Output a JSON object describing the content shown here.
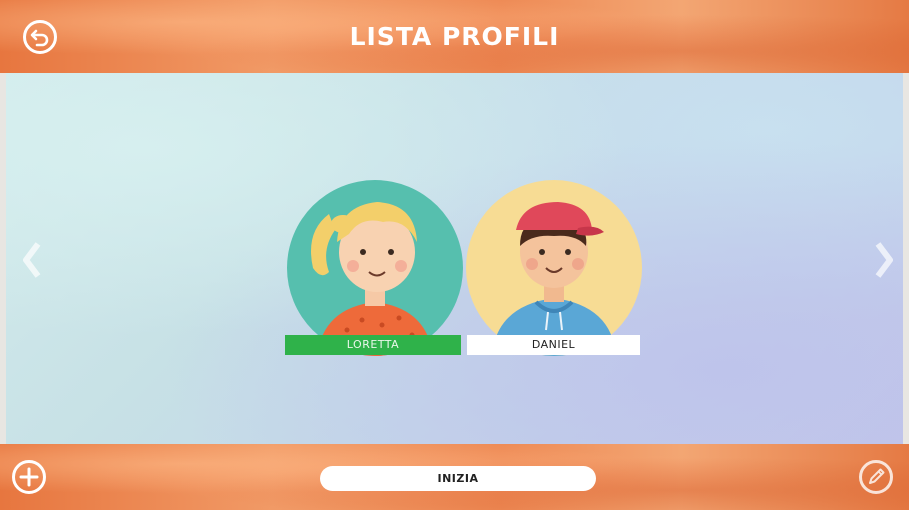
{
  "header": {
    "title": "LISTA PROFILI",
    "back_icon": "back-arrow-circle-icon"
  },
  "profiles": [
    {
      "name": "LORETTA",
      "selected": true,
      "label_color": "#2fb24a",
      "circle_color": "#56bfae"
    },
    {
      "name": "DANIEL",
      "selected": false,
      "label_color": "#ffffff",
      "circle_color": "#f7dc94"
    }
  ],
  "navigation": {
    "prev_icon": "chevron-left-icon",
    "next_icon": "chevron-right-icon"
  },
  "footer": {
    "start_label": "INIZIA",
    "add_icon": "plus-circle-icon",
    "edit_icon": "pencil-circle-icon"
  },
  "colors": {
    "bar_orange": "#ee8a55",
    "selected_green": "#2fb24a"
  }
}
